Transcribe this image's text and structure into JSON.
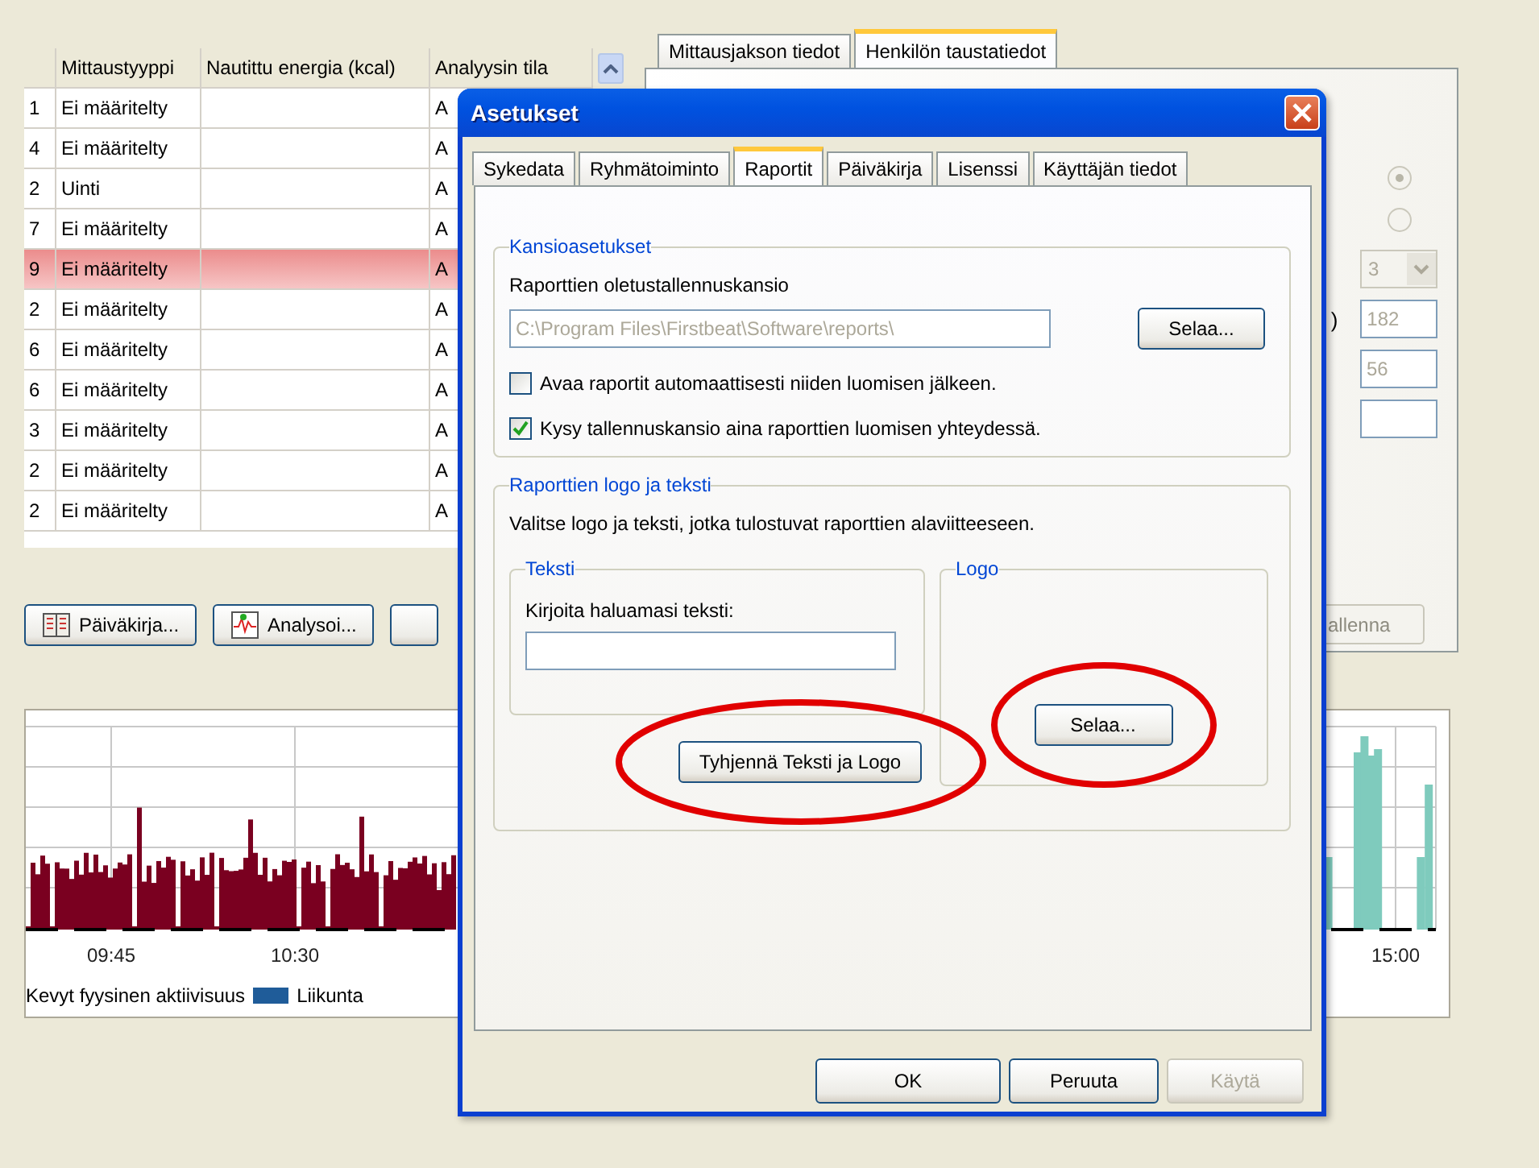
{
  "background": {
    "table": {
      "columns": [
        "",
        "Mittaustyyppi",
        "Nautittu energia (kcal)",
        "Analyysin tila"
      ],
      "rows": [
        {
          "cells": [
            "1",
            "Ei määritelty",
            "",
            "A"
          ],
          "selected": false
        },
        {
          "cells": [
            "4",
            "Ei määritelty",
            "",
            "A"
          ],
          "selected": false
        },
        {
          "cells": [
            "2",
            "Uinti",
            "",
            "A"
          ],
          "selected": false
        },
        {
          "cells": [
            "7",
            "Ei määritelty",
            "",
            "A"
          ],
          "selected": false
        },
        {
          "cells": [
            "9",
            "Ei määritelty",
            "",
            "A"
          ],
          "selected": true
        },
        {
          "cells": [
            "2",
            "Ei määritelty",
            "",
            "A"
          ],
          "selected": false
        },
        {
          "cells": [
            "6",
            "Ei määritelty",
            "",
            "A"
          ],
          "selected": false
        },
        {
          "cells": [
            "6",
            "Ei määritelty",
            "",
            "A"
          ],
          "selected": false
        },
        {
          "cells": [
            "3",
            "Ei määritelty",
            "",
            "A"
          ],
          "selected": false
        },
        {
          "cells": [
            "2",
            "Ei määritelty",
            "",
            "A"
          ],
          "selected": false
        },
        {
          "cells": [
            "2",
            "Ei määritelty",
            "",
            "A"
          ],
          "selected": false
        }
      ]
    },
    "buttons": [
      {
        "label": "Päiväkirja...",
        "kind": "diary"
      },
      {
        "label": "Analysoi...",
        "kind": "analyze"
      },
      {
        "kind": "blank"
      }
    ],
    "chart": {
      "time_labels": [
        "09:45",
        "10:30",
        "15:00"
      ],
      "legend": [
        {
          "label": "Kevyt fyysinen aktiivisuus"
        },
        {
          "label": "Liikunta",
          "color": "#1f5c99"
        }
      ]
    },
    "side_panel": {
      "tabs": [
        {
          "label": "Mittausjakson tiedot",
          "selected": false
        },
        {
          "label": "Henkilön taustatiedot",
          "selected": true
        }
      ],
      "radios": [
        {
          "selected": true
        },
        {
          "selected": false
        }
      ],
      "select": "3",
      "paren": ")",
      "fields": [
        {
          "kind": "filled",
          "value": "182"
        },
        {
          "kind": "filled",
          "value": "56"
        },
        {
          "kind": "blank"
        }
      ],
      "save_button": "allenna"
    }
  },
  "dialog": {
    "title": "Asetukset",
    "tabs": [
      {
        "label": "Sykedata",
        "selected": false
      },
      {
        "label": "Ryhmätoiminto",
        "selected": false
      },
      {
        "label": "Raportit",
        "selected": true
      },
      {
        "label": "Päiväkirja",
        "selected": false
      },
      {
        "label": "Lisenssi",
        "selected": false
      },
      {
        "label": "Käyttäjän tiedot",
        "selected": false
      }
    ],
    "folder_group": {
      "title": "Kansioasetukset",
      "label": "Raporttien oletustallennuskansio",
      "path": "C:\\Program Files\\Firstbeat\\Software\\reports\\",
      "browse": {
        "label": "Selaa..."
      },
      "checkboxes": [
        {
          "label": "Avaa raportit automaattisesti niiden luomisen jälkeen.",
          "checked": false
        },
        {
          "label": "Kysy tallennuskansio aina raporttien luomisen yhteydessä.",
          "checked": true
        }
      ]
    },
    "logo_group": {
      "title": "Raporttien logo ja teksti",
      "description": "Valitse logo ja teksti, jotka tulostuvat raporttien alaviitteeseen.",
      "text_box": {
        "title": "Teksti",
        "label": "Kirjoita haluamasi teksti:"
      },
      "clear_button": {
        "label": "Tyhjennä Teksti ja Logo",
        "highlighted": true
      },
      "logo_box": {
        "title": "Logo"
      },
      "browse": {
        "label": "Selaa...",
        "highlighted": true
      }
    },
    "buttons": [
      {
        "label": "OK",
        "disabled": false
      },
      {
        "label": "Peruuta",
        "disabled": false
      },
      {
        "label": "Käytä",
        "disabled": true
      }
    ]
  }
}
